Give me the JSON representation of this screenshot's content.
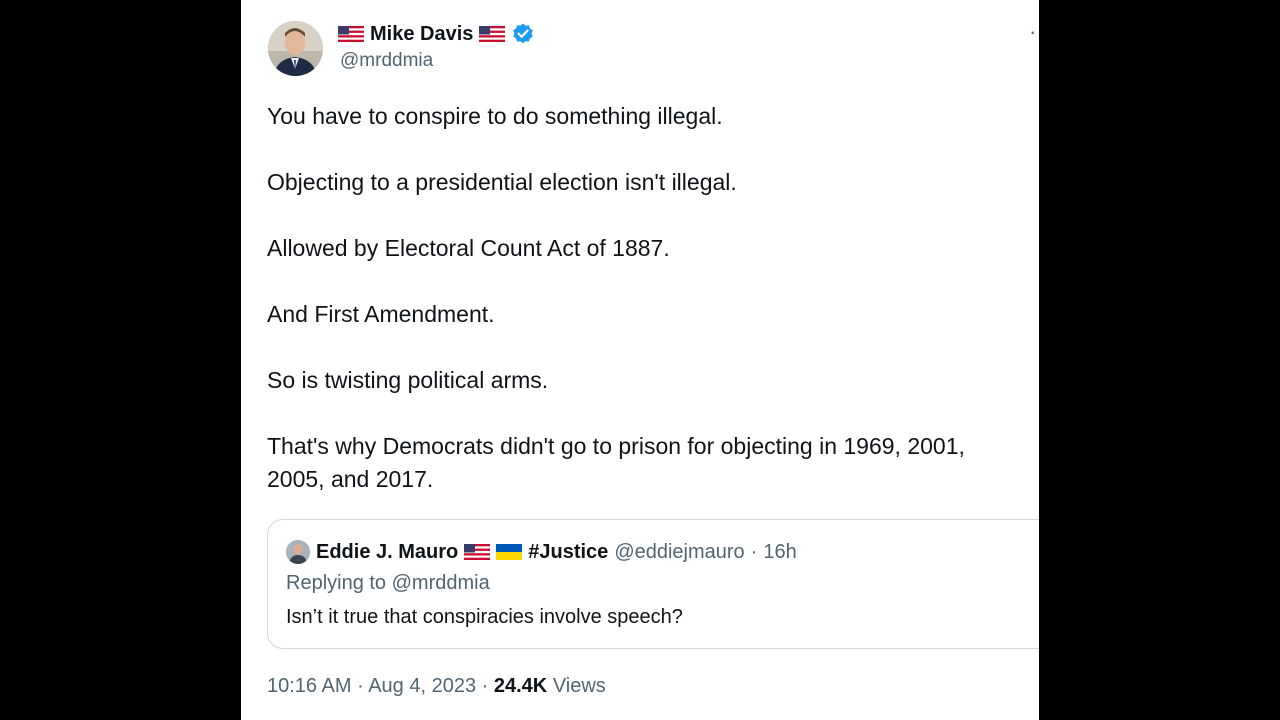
{
  "tweet": {
    "author": {
      "display_name": "Mike Davis",
      "handle": "@mrddmia",
      "flag_icon": "us-flag-icon",
      "verified_icon": "verified-badge-icon",
      "verified_color": "#1d9bf0"
    },
    "more_icon": "more-options-icon",
    "paragraphs": [
      "You have to conspire to do something illegal.",
      "Objecting to a presidential election isn't illegal.",
      "Allowed by Electoral Count Act of 1887.",
      "And First Amendment.",
      "So is twisting political arms.",
      "That's why Democrats didn't go to prison for objecting in 1969, 2001,\n2005, and 2017."
    ],
    "quoted": {
      "display_name": "Eddie J. Mauro",
      "tag": "#Justice",
      "handle": "@eddiejmauro",
      "separator": "·",
      "age": "16h",
      "replying_to": "Replying to @mrddmia",
      "text": "Isn’t it true that conspiracies involve speech?"
    },
    "meta": {
      "time": "10:16 AM",
      "separator": "·",
      "date": "Aug 4, 2023",
      "views_count": "24.4K",
      "views_label": "Views"
    }
  }
}
